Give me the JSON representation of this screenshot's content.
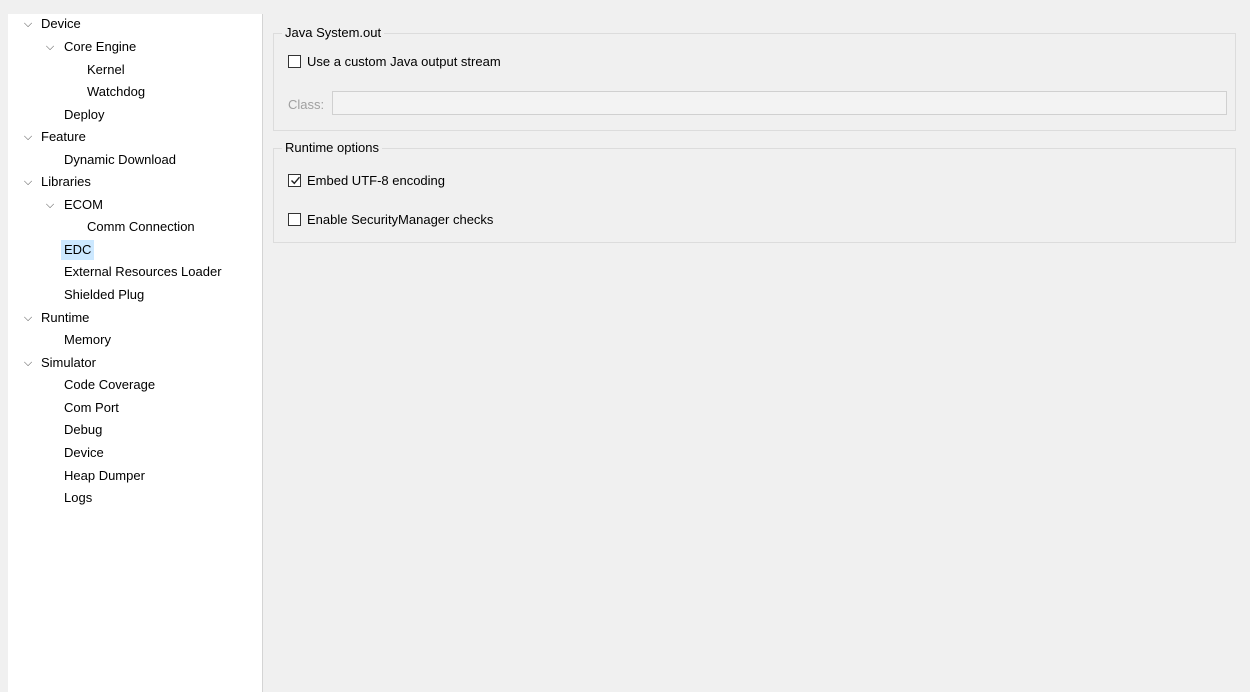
{
  "tree": {
    "device": "Device",
    "core_engine": "Core Engine",
    "kernel": "Kernel",
    "watchdog": "Watchdog",
    "deploy": "Deploy",
    "feature": "Feature",
    "dynamic_download": "Dynamic Download",
    "libraries": "Libraries",
    "ecom": "ECOM",
    "comm_connection": "Comm Connection",
    "edc": "EDC",
    "external_resources_loader": "External Resources Loader",
    "shielded_plug": "Shielded Plug",
    "runtime": "Runtime",
    "memory": "Memory",
    "simulator": "Simulator",
    "code_coverage": "Code Coverage",
    "com_port": "Com Port",
    "debug": "Debug",
    "sim_device": "Device",
    "heap_dumper": "Heap Dumper",
    "logs": "Logs",
    "selected": "EDC"
  },
  "java_system_out": {
    "title": "Java System.out",
    "custom_stream_label": "Use a custom Java output stream",
    "custom_stream_checked": false,
    "class_label": "Class:",
    "class_value": ""
  },
  "runtime_options": {
    "title": "Runtime options",
    "utf8_label": "Embed UTF-8 encoding",
    "utf8_checked": true,
    "security_label": "Enable SecurityManager checks",
    "security_checked": false
  },
  "icons": {
    "expand": "chevron-down-icon",
    "checked": "checkmark-icon"
  },
  "colors": {
    "selection": "#cce8ff",
    "panel_bg": "#f0f0f0",
    "tree_bg": "#ffffff"
  }
}
